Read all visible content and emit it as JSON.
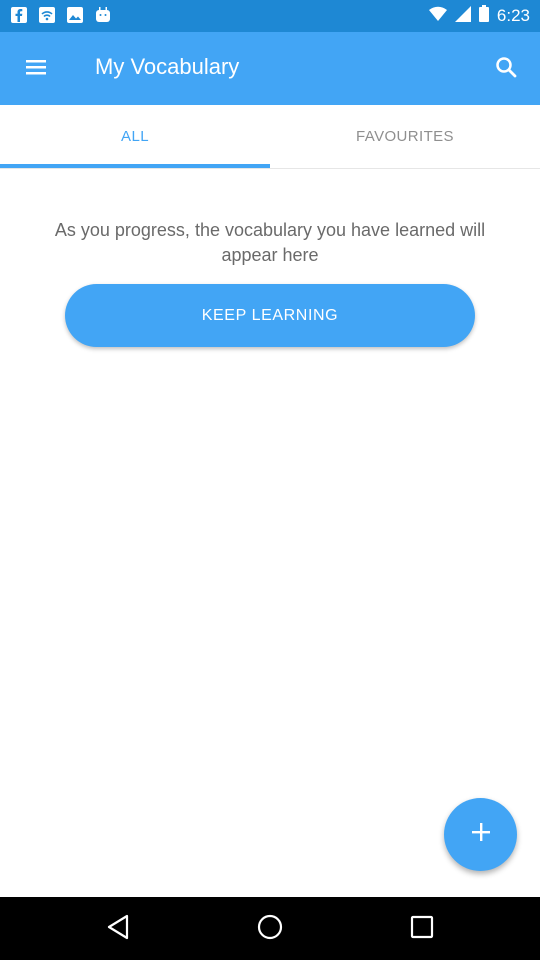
{
  "status_bar": {
    "time": "6:23",
    "icons": [
      "facebook-icon",
      "wifi-square-icon",
      "photo-icon",
      "android-icon",
      "wifi-icon",
      "signal-icon",
      "battery-icon"
    ]
  },
  "app_bar": {
    "title": "My Vocabulary",
    "icons": [
      "menu-icon",
      "search-icon"
    ]
  },
  "tabs": [
    {
      "label": "ALL",
      "selected": true
    },
    {
      "label": "FAVOURITES",
      "selected": false
    }
  ],
  "content": {
    "empty_message": "As you progress, the vocabulary you have learned will appear here",
    "button_label": "KEEP LEARNING"
  },
  "fab": {
    "icon": "plus-icon"
  },
  "nav_bar": {
    "icons": [
      "back-icon",
      "home-icon",
      "recent-apps-icon"
    ]
  },
  "colors": {
    "primary": "#42a5f5",
    "status_bar": "#1e88d4",
    "text_secondary": "#6a6a6a",
    "tab_inactive": "#8f8f8f"
  }
}
